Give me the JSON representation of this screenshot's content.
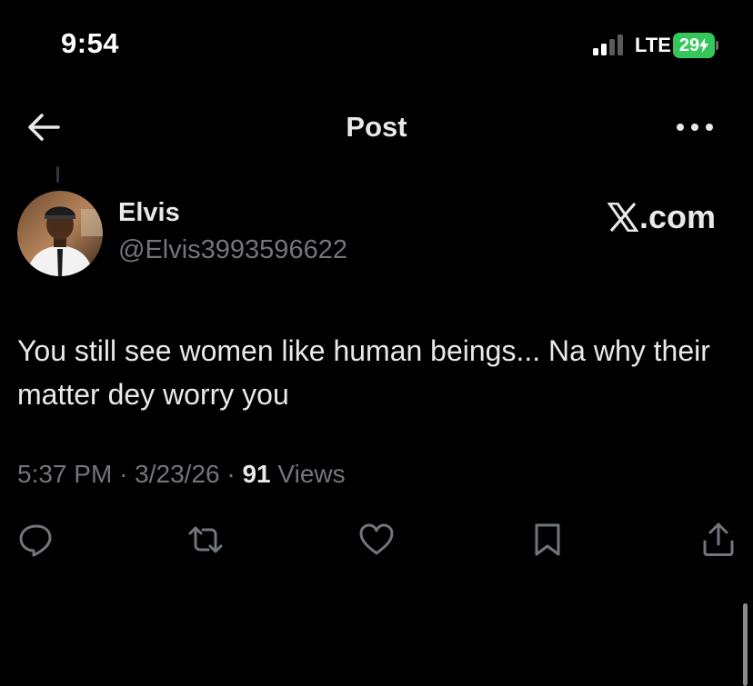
{
  "status_bar": {
    "time": "9:54",
    "network": "LTE",
    "battery": "29",
    "battery_color": "#34c759"
  },
  "header": {
    "title": "Post",
    "back_icon": "arrow-left-icon",
    "more_icon": "more-horizontal-icon"
  },
  "post": {
    "author_name": "Elvis",
    "author_handle": "@Elvis3993596622",
    "watermark_text": ".com",
    "text": "You still see women like human beings... Na why their matter dey worry you",
    "time": "5:37 PM",
    "date": "3/23/26",
    "views_count": "91",
    "views_label": "Views"
  },
  "actions": [
    {
      "icon": "reply-icon"
    },
    {
      "icon": "retweet-icon"
    },
    {
      "icon": "heart-icon"
    },
    {
      "icon": "bookmark-icon"
    },
    {
      "icon": "share-icon"
    }
  ],
  "colors": {
    "background": "#000000",
    "text": "#e7e9ea",
    "secondary": "#71767b"
  }
}
